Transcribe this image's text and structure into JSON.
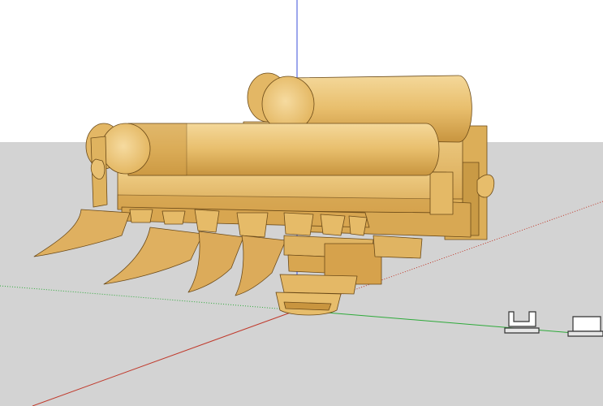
{
  "viewport": {
    "sky_color": "#ffffff",
    "ground_color": "#d3d3d3"
  },
  "axes": {
    "red_axis_color": "#c0392b",
    "green_axis_color": "#2eaa3a",
    "blue_axis_color": "#3b4fd8"
  },
  "model": {
    "wood_light": "#edc777",
    "wood_mid": "#ddb05b",
    "wood_dark": "#b98634",
    "wood_edge": "#6b4a18"
  },
  "scale_figures": {
    "count": 2,
    "fill": "#ffffff",
    "stroke": "#333333"
  }
}
